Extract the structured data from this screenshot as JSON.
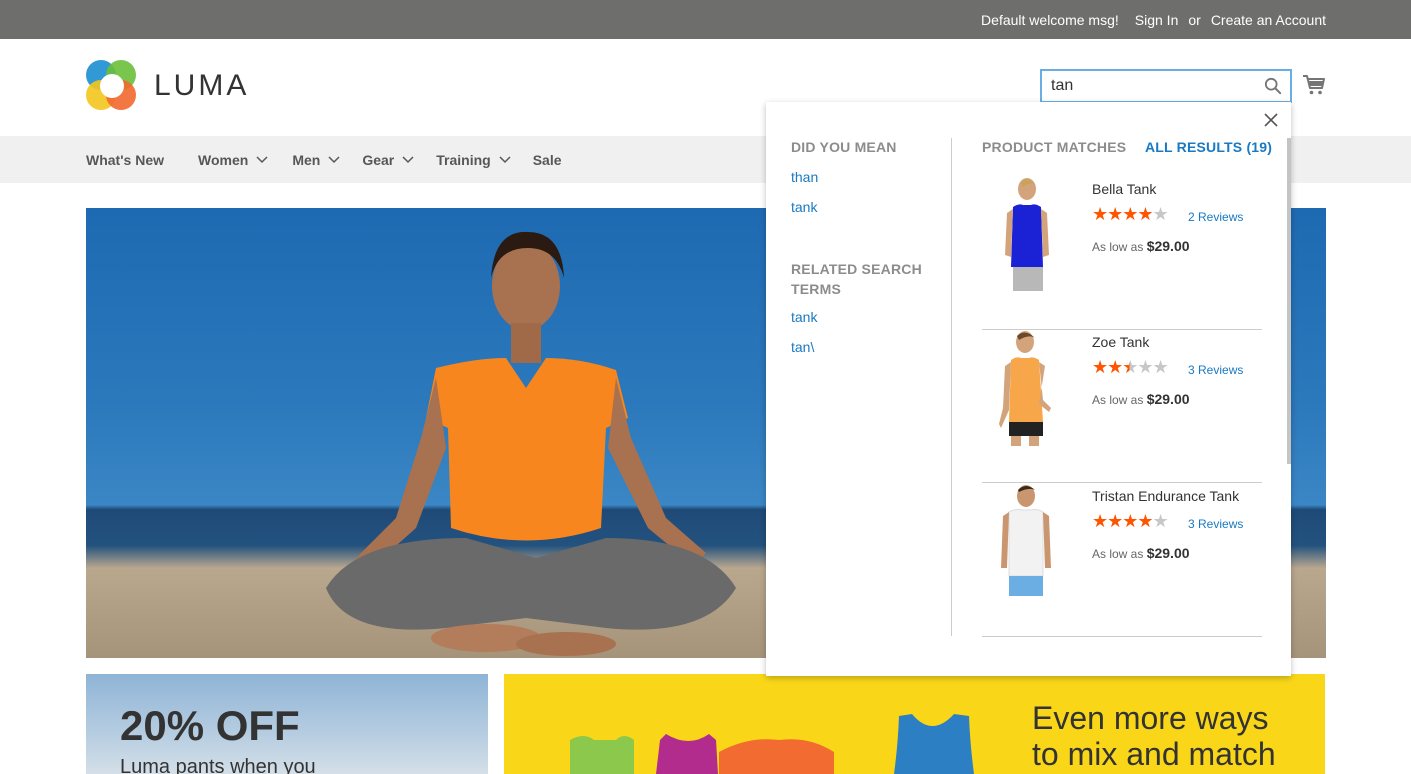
{
  "topbar": {
    "welcome": "Default welcome msg!",
    "sign_in": "Sign In",
    "or": "or",
    "create_account": "Create an Account"
  },
  "header": {
    "logo_text": "LUMA",
    "search_value": "tan"
  },
  "nav": {
    "items": [
      "What's New",
      "Women",
      "Men",
      "Gear",
      "Training",
      "Sale"
    ]
  },
  "promo1": {
    "headline": "20% OFF",
    "subtext": "Luma pants when you"
  },
  "promo2": {
    "headline_line1": "Even more ways",
    "headline_line2": "to mix and match"
  },
  "autocomplete": {
    "did_you_mean_heading": "DID YOU MEAN",
    "did_you_mean": [
      "than",
      "tank"
    ],
    "related_heading_line1": "RELATED SEARCH",
    "related_heading_line2": "TERMS",
    "related": [
      "tank",
      "tan\\"
    ],
    "products_heading": "PRODUCT MATCHES",
    "all_results": "ALL RESULTS (19)",
    "products": [
      {
        "name": "Bella Tank",
        "rating": 4,
        "reviews": "2  Reviews",
        "price_label": "As low as",
        "price": "$29.00",
        "color": "#1b22d6"
      },
      {
        "name": "Zoe Tank",
        "rating": 2.5,
        "reviews": "3  Reviews",
        "price_label": "As low as",
        "price": "$29.00",
        "color": "#f7a74a"
      },
      {
        "name": "Tristan Endurance Tank",
        "rating": 4,
        "reviews": "3  Reviews",
        "price_label": "As low as",
        "price": "$29.00",
        "color": "#f2f2f2"
      }
    ]
  },
  "colors": {
    "link": "#1979c3",
    "star": "#ff5501",
    "topbar": "#6e6e6c",
    "promo_yellow": "#f9d718"
  }
}
